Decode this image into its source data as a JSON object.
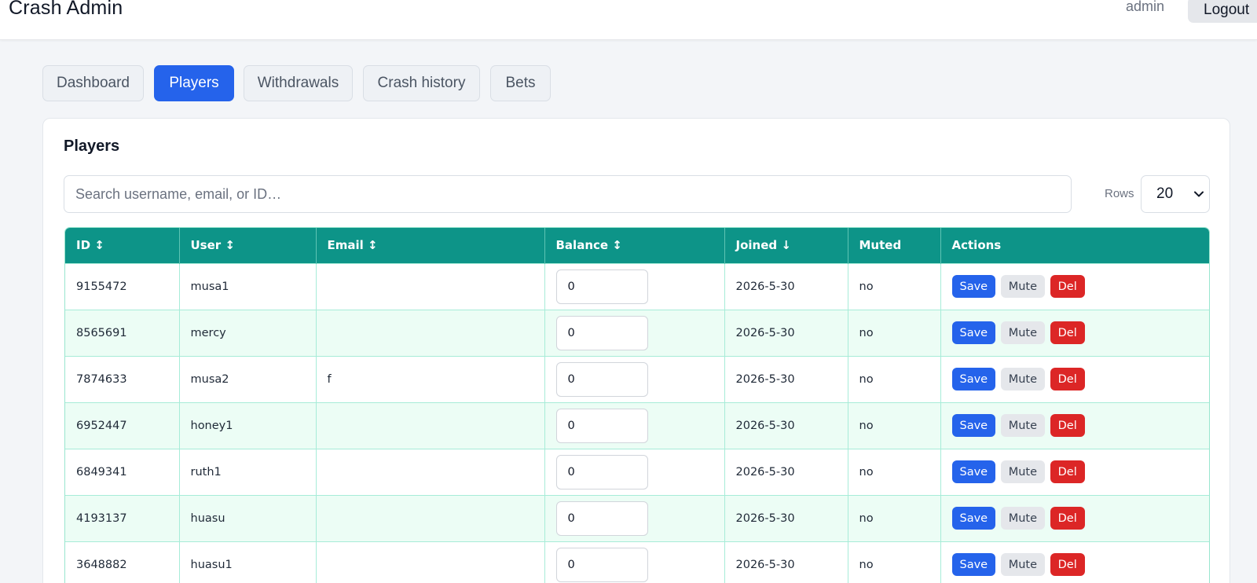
{
  "header": {
    "brand": "Crash Admin",
    "username": "admin",
    "logout_label": "Logout"
  },
  "tabs": [
    {
      "label": "Dashboard",
      "active": false
    },
    {
      "label": "Players",
      "active": true
    },
    {
      "label": "Withdrawals",
      "active": false
    },
    {
      "label": "Crash history",
      "active": false
    },
    {
      "label": "Bets",
      "active": false
    }
  ],
  "players": {
    "title": "Players",
    "search_placeholder": "Search username, email, or ID…",
    "search_value": "",
    "rows_label": "Rows",
    "rows_value": "20",
    "columns": [
      "ID ↕",
      "User ↕",
      "Email ↕",
      "Balance ↕",
      "Joined ↓",
      "Muted",
      "Actions"
    ],
    "actions": {
      "save": "Save",
      "mute": "Mute",
      "del": "Del"
    },
    "rows": [
      {
        "id": "9155472",
        "user": "musa1",
        "email": "",
        "balance": "0",
        "joined": "2026-5-30",
        "muted": "no"
      },
      {
        "id": "8565691",
        "user": "mercy",
        "email": "",
        "balance": "0",
        "joined": "2026-5-30",
        "muted": "no"
      },
      {
        "id": "7874633",
        "user": "musa2",
        "email": "f",
        "balance": "0",
        "joined": "2026-5-30",
        "muted": "no"
      },
      {
        "id": "6952447",
        "user": "honey1",
        "email": "",
        "balance": "0",
        "joined": "2026-5-30",
        "muted": "no"
      },
      {
        "id": "6849341",
        "user": "ruth1",
        "email": "",
        "balance": "0",
        "joined": "2026-5-30",
        "muted": "no"
      },
      {
        "id": "4193137",
        "user": "huasu",
        "email": "",
        "balance": "0",
        "joined": "2026-5-30",
        "muted": "no"
      },
      {
        "id": "3648882",
        "user": "huasu1",
        "email": "",
        "balance": "0",
        "joined": "2026-5-30",
        "muted": "no"
      }
    ]
  },
  "colors": {
    "primary": "#2563eb",
    "table_header": "#0d9488",
    "row_alt": "#ecfdf5",
    "danger": "#dc2626",
    "neutral_button": "#e5e7eb"
  }
}
